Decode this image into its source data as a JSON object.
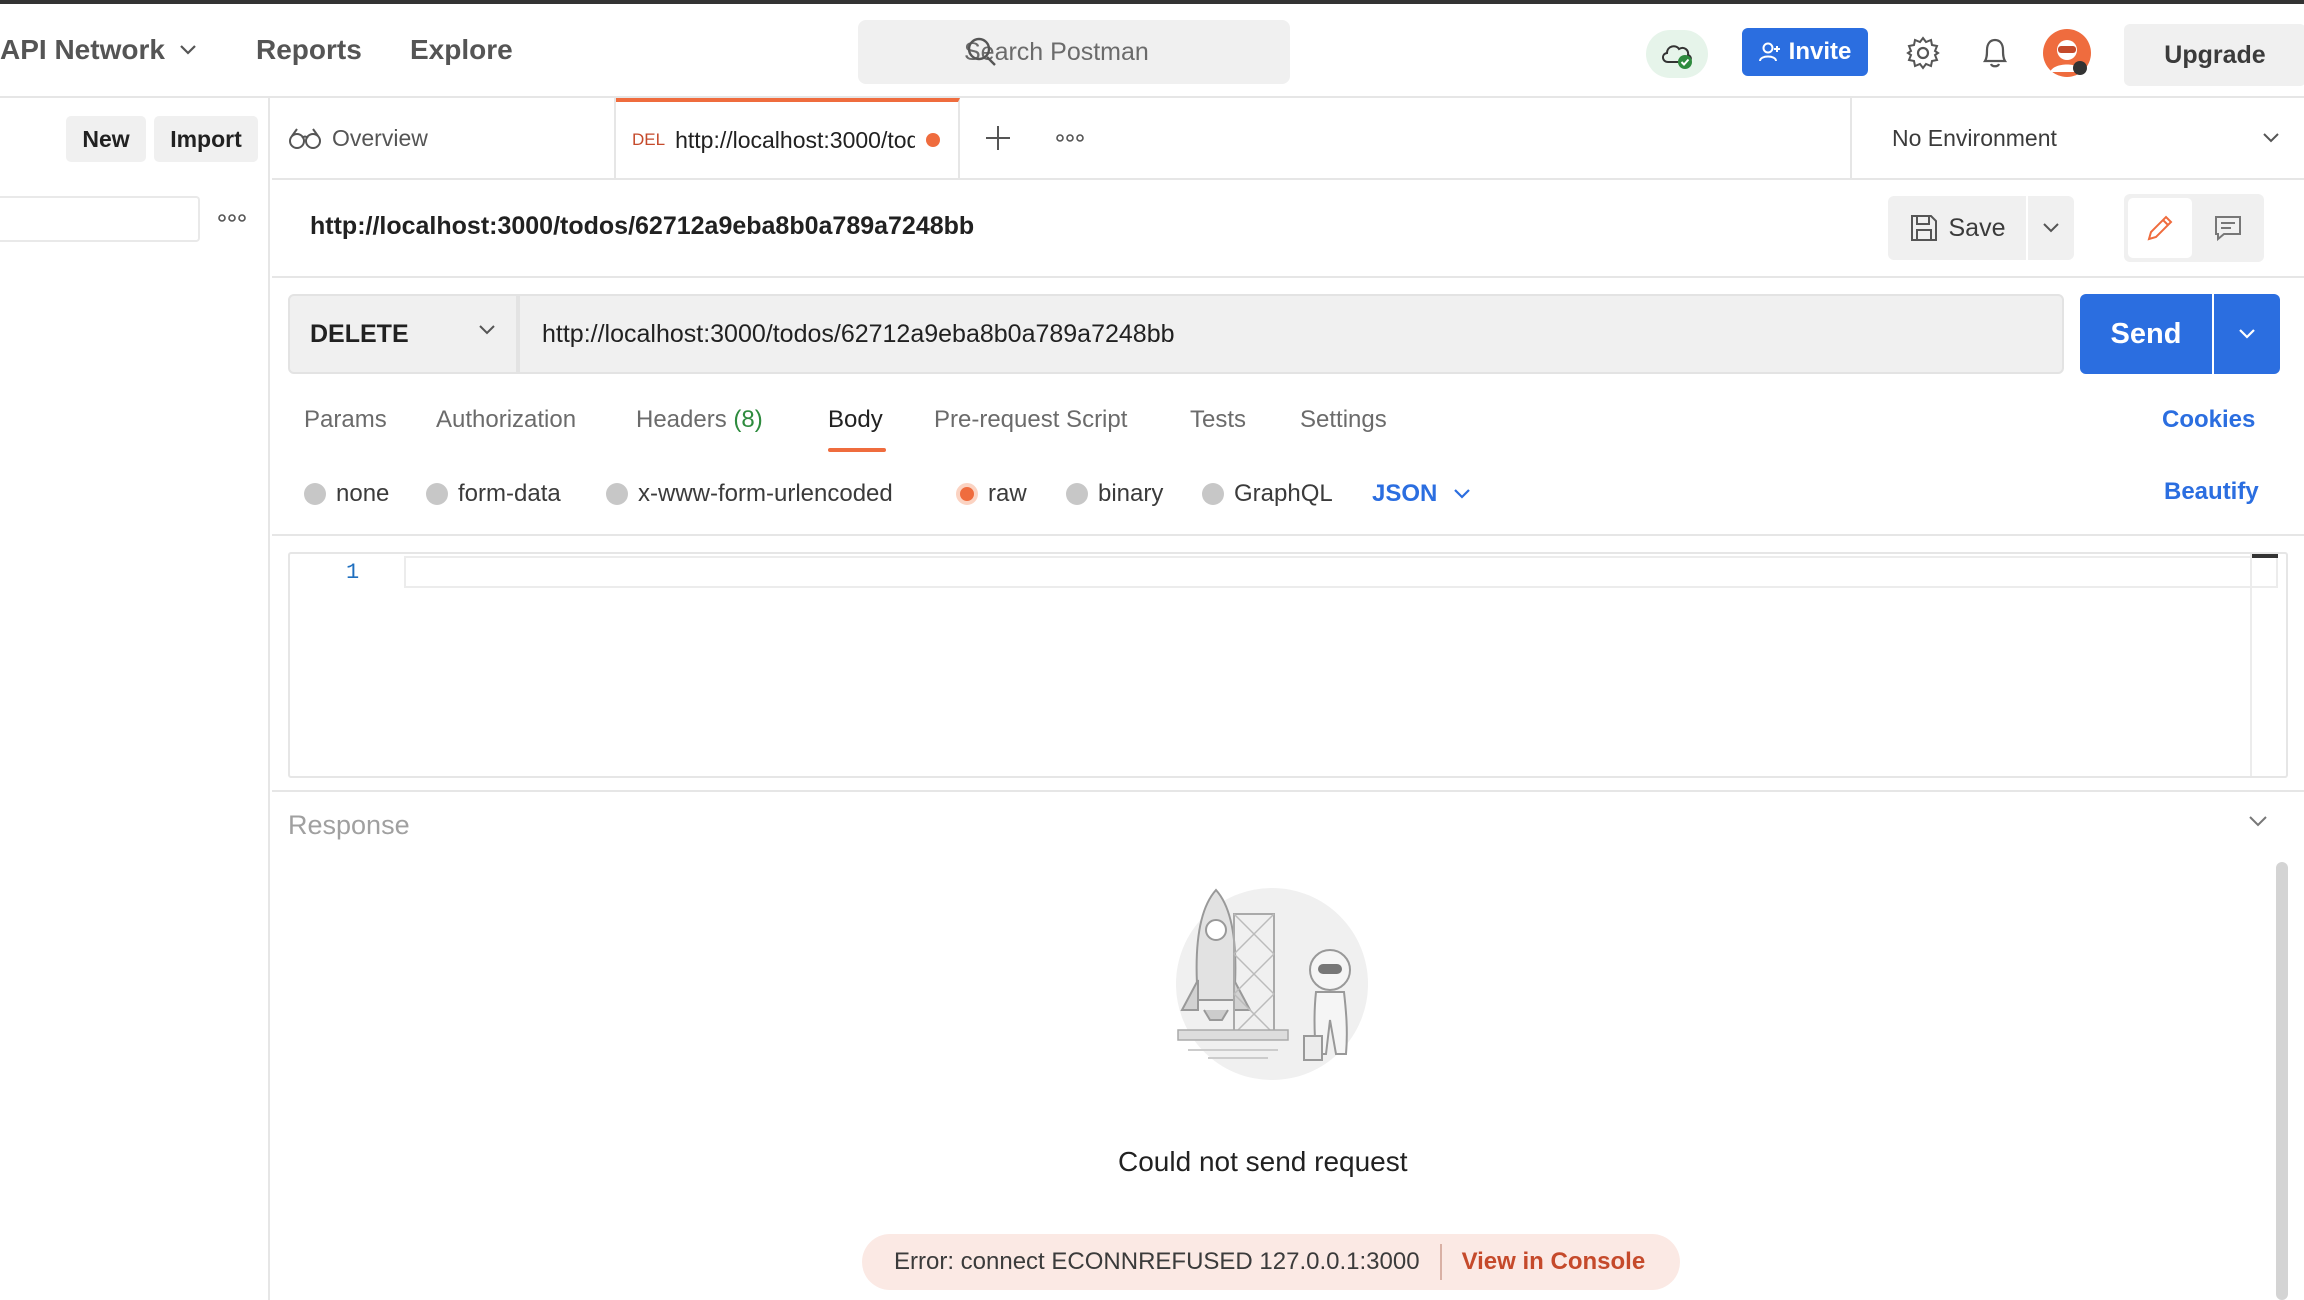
{
  "header": {
    "nav": [
      {
        "label": "API Network"
      },
      {
        "label": "Reports"
      },
      {
        "label": "Explore"
      }
    ],
    "search_placeholder": "Search Postman",
    "invite_label": "Invite",
    "upgrade_label": "Upgrade"
  },
  "sidebar": {
    "new_label": "New",
    "import_label": "Import"
  },
  "tabs": {
    "overview_label": "Overview",
    "active_method": "DEL",
    "active_url": "http://localhost:3000/todos/62712a9eba8b0a789a7248bb",
    "environment": "No Environment"
  },
  "request": {
    "title": "http://localhost:3000/todos/62712a9eba8b0a789a7248bb",
    "save_label": "Save",
    "method": "DELETE",
    "url": "http://localhost:3000/todos/62712a9eba8b0a789a7248bb",
    "send_label": "Send",
    "tabs": {
      "params": "Params",
      "authorization": "Authorization",
      "headers": "Headers",
      "headers_count": "(8)",
      "body": "Body",
      "prerequest": "Pre-request Script",
      "tests": "Tests",
      "settings": "Settings"
    },
    "cookies_label": "Cookies",
    "body_types": {
      "none": "none",
      "form_data": "form-data",
      "urlencoded": "x-www-form-urlencoded",
      "raw": "raw",
      "binary": "binary",
      "graphql": "GraphQL"
    },
    "selected_body_type": "raw",
    "language": "JSON",
    "beautify_label": "Beautify",
    "editor_line": "1"
  },
  "response": {
    "title": "Response",
    "error_title": "Could not send request",
    "error_message": "Error: connect ECONNREFUSED 127.0.0.1:3000",
    "console_link": "View in Console"
  },
  "colors": {
    "accent": "#ef6c3e",
    "primary": "#2b6ee0",
    "success": "#2e8b3e"
  }
}
